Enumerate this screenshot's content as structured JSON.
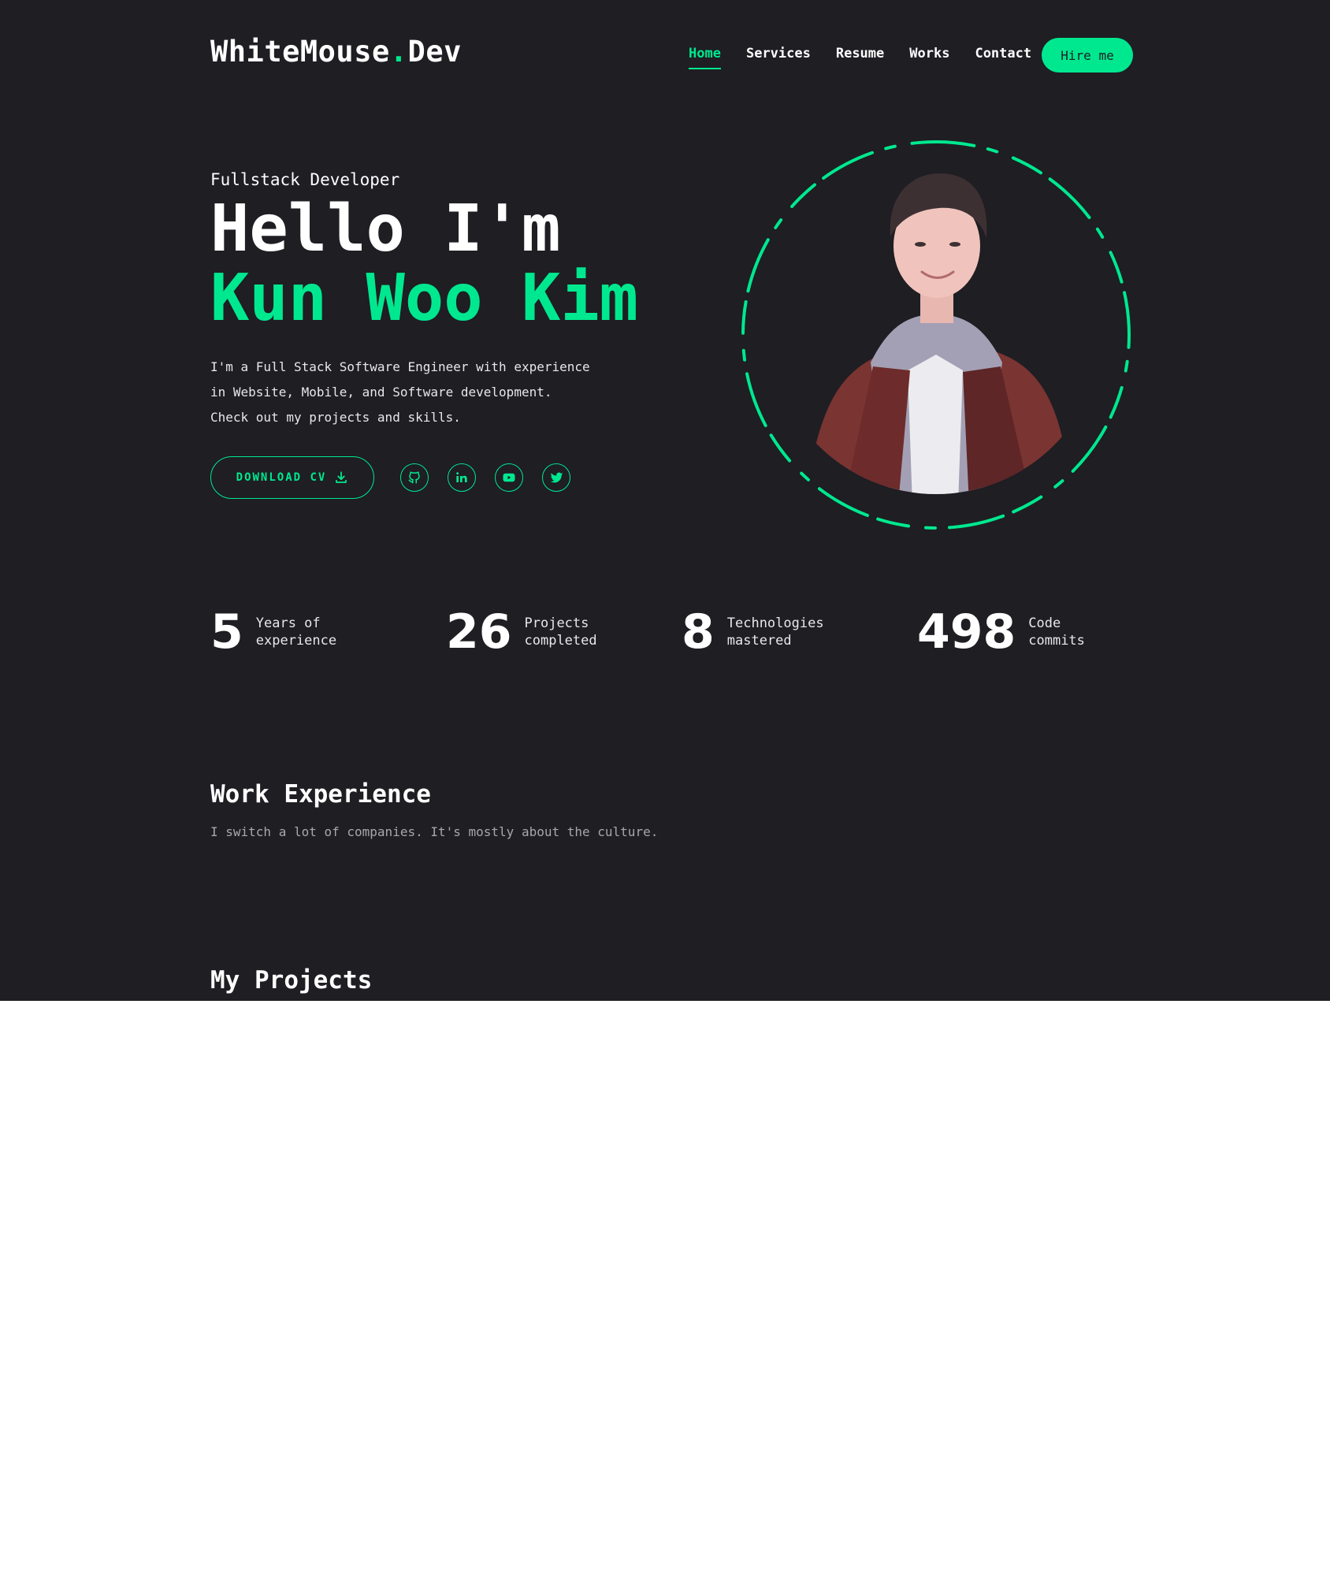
{
  "header": {
    "logo_main": "WhiteMouse",
    "logo_dot": ".",
    "logo_suffix": "Dev",
    "nav": [
      "Home",
      "Services",
      "Resume",
      "Works",
      "Contact"
    ],
    "hire_label": "Hire me"
  },
  "hero": {
    "role": "Fullstack Developer",
    "greeting": "Hello I'm",
    "name": "Kun Woo Kim",
    "description": [
      "I'm a Full Stack Software Engineer with experience",
      "in Website, Mobile, and Software development.",
      "Check out my projects and skills."
    ],
    "cv_label": "DOWNLOAD CV",
    "cv_icon": "download-icon",
    "socials": [
      "github-icon",
      "linkedin-icon",
      "youtube-icon",
      "twitter-icon"
    ]
  },
  "stats": [
    {
      "number": "5",
      "label_line1": "Years of",
      "label_line2": "experience"
    },
    {
      "number": "26",
      "label_line1": "Projects",
      "label_line2": "completed"
    },
    {
      "number": "8",
      "label_line1": "Technologies",
      "label_line2": "mastered"
    },
    {
      "number": "498",
      "label_line1": "Code",
      "label_line2": "commits"
    }
  ],
  "work_experience": {
    "title": "Work Experience",
    "subtitle": "I switch a lot of companies. It's mostly about the culture."
  },
  "projects": {
    "title": "My Projects"
  },
  "colors": {
    "accent": "#00e88f",
    "background": "#1e1e23",
    "text": "#ffffff"
  }
}
